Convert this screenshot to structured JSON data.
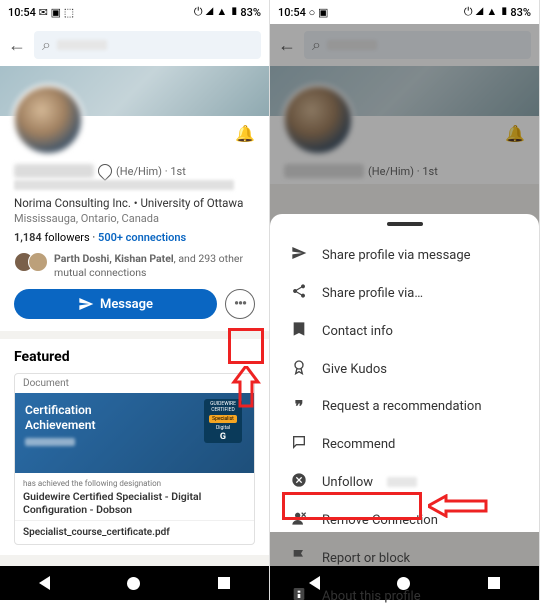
{
  "status": {
    "time": "10:54",
    "battery": "83%"
  },
  "profile": {
    "pronouns": "(He/Him)",
    "degree": "1st",
    "company_line": "Norima Consulting Inc. • University of Ottawa",
    "location": "Mississauga, Ontario, Canada",
    "followers_count": "1,184",
    "followers_label": "followers",
    "connections": "500+ connections",
    "mutual_names": "Parth Doshi, Kishan Patel",
    "mutual_rest": ", and 293 other mutual connections",
    "message_btn": "Message"
  },
  "featured": {
    "heading": "Featured",
    "doc_label": "Document",
    "cert_title_1": "Certification",
    "cert_title_2": "Achievement",
    "badge_top": "GUIDEWIRE CERTIFIED",
    "badge_mid": "Specialist",
    "badge_bot": "Digital",
    "caption": "has achieved the following designation",
    "doc_title": "Guidewire Certified Specialist - Digital Configuration - Dobson",
    "filename": "Specialist_course_certificate.pdf"
  },
  "menu": {
    "items": [
      "Share profile via message",
      "Share profile via…",
      "Contact info",
      "Give Kudos",
      "Request a recommendation",
      "Recommend",
      "Unfollow",
      "Remove Connection",
      "Report or block",
      "About this profile"
    ]
  }
}
